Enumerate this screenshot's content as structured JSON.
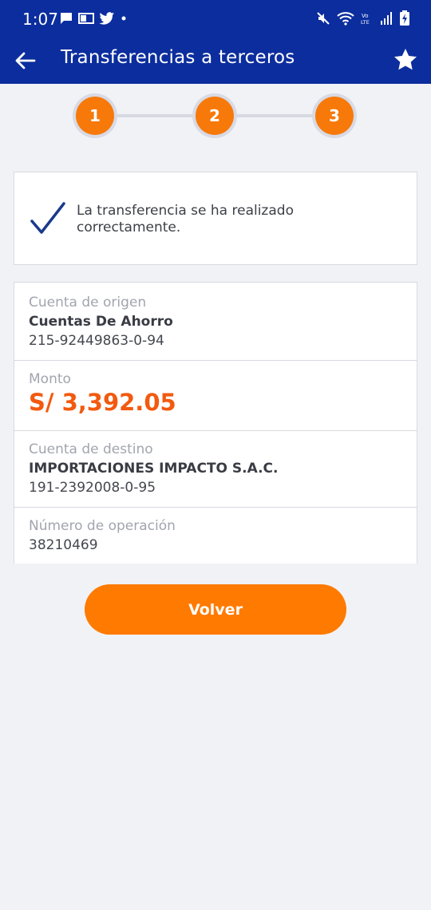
{
  "status_bar": {
    "time": "1:07",
    "icons_left": [
      "message-icon",
      "outlook-icon",
      "twitter-icon",
      "dot-icon"
    ],
    "icons_right": [
      "mute-icon",
      "wifi-icon",
      "volte-icon",
      "signal-icon",
      "battery-charging-icon"
    ],
    "volte_top": "Vo",
    "volte_bottom": "LTE"
  },
  "app_bar": {
    "title": "Transferencias a terceros",
    "back_icon": "arrow-left-icon",
    "favorite_icon": "star-icon",
    "background": "#0b2d9e"
  },
  "stepper": {
    "steps": [
      "1",
      "2",
      "3"
    ],
    "active_color": "#f7790a"
  },
  "success": {
    "icon": "check-icon",
    "message": "La transferencia se ha realizado correctamente."
  },
  "details": {
    "origin_label": "Cuenta de origen",
    "origin_name": "Cuentas De Ahorro",
    "origin_number": "215-92449863-0-94",
    "amount_label": "Monto",
    "amount_value": "S/ 3,392.05",
    "destination_label": "Cuenta de destino",
    "destination_name": "IMPORTACIONES IMPACTO S.A.C.",
    "destination_number": "191-2392008-0-95",
    "operation_label": "Número de operación",
    "operation_number": "38210469"
  },
  "actions": {
    "back_label": "Volver",
    "button_color": "#ff7a00"
  }
}
